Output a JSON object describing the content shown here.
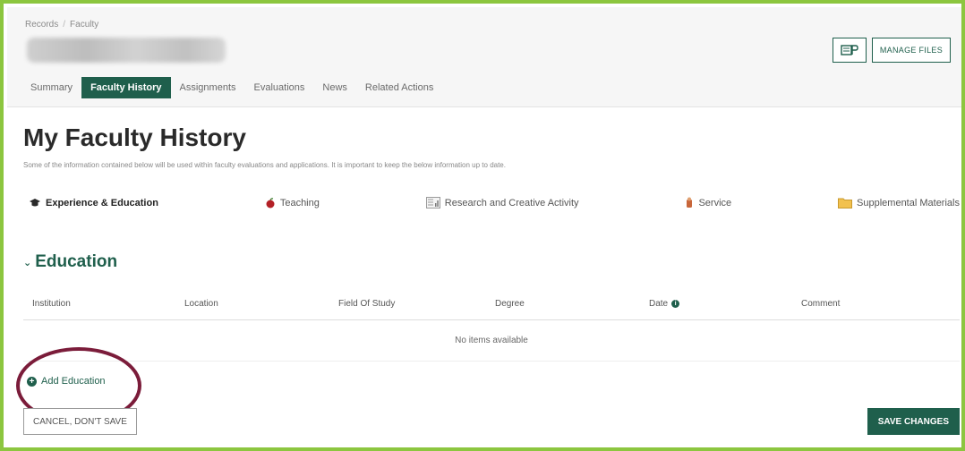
{
  "breadcrumb": {
    "items": [
      "Records",
      "Faculty"
    ]
  },
  "record": {
    "name": ""
  },
  "header_actions": {
    "files_icon": "files-icon",
    "manage_files_label": "Manage Files"
  },
  "record_tabs": [
    {
      "label": "Summary",
      "active": false
    },
    {
      "label": "Faculty History",
      "active": true
    },
    {
      "label": "Assignments",
      "active": false
    },
    {
      "label": "Evaluations",
      "active": false
    },
    {
      "label": "News",
      "active": false
    },
    {
      "label": "Related Actions",
      "active": false
    }
  ],
  "page": {
    "title": "My Faculty History",
    "subtitle": "Some of the information contained below will be used within faculty evaluations and applications. It is important to keep the below information up to date."
  },
  "section_tabs": [
    {
      "label": "Experience & Education",
      "icon": "graduation-cap-icon",
      "active": true
    },
    {
      "label": "Teaching",
      "icon": "apple-icon",
      "active": false
    },
    {
      "label": "Research and Creative Activity",
      "icon": "document-chart-icon",
      "active": false
    },
    {
      "label": "Service",
      "icon": "service-icon",
      "active": false
    },
    {
      "label": "Supplemental Materials",
      "icon": "folder-icon",
      "active": false
    }
  ],
  "education": {
    "header": "Education",
    "columns": [
      "Institution",
      "Location",
      "Field Of Study",
      "Degree",
      "Date",
      "Comment"
    ],
    "empty_message": "No items available",
    "add_label": "Add Education"
  },
  "footer": {
    "cancel_label": "Cancel, Don't Save",
    "save_label": "Save Changes"
  },
  "colors": {
    "accent": "#1f5f4c",
    "frame": "#8cc63f",
    "highlight": "#7b1c3a"
  }
}
